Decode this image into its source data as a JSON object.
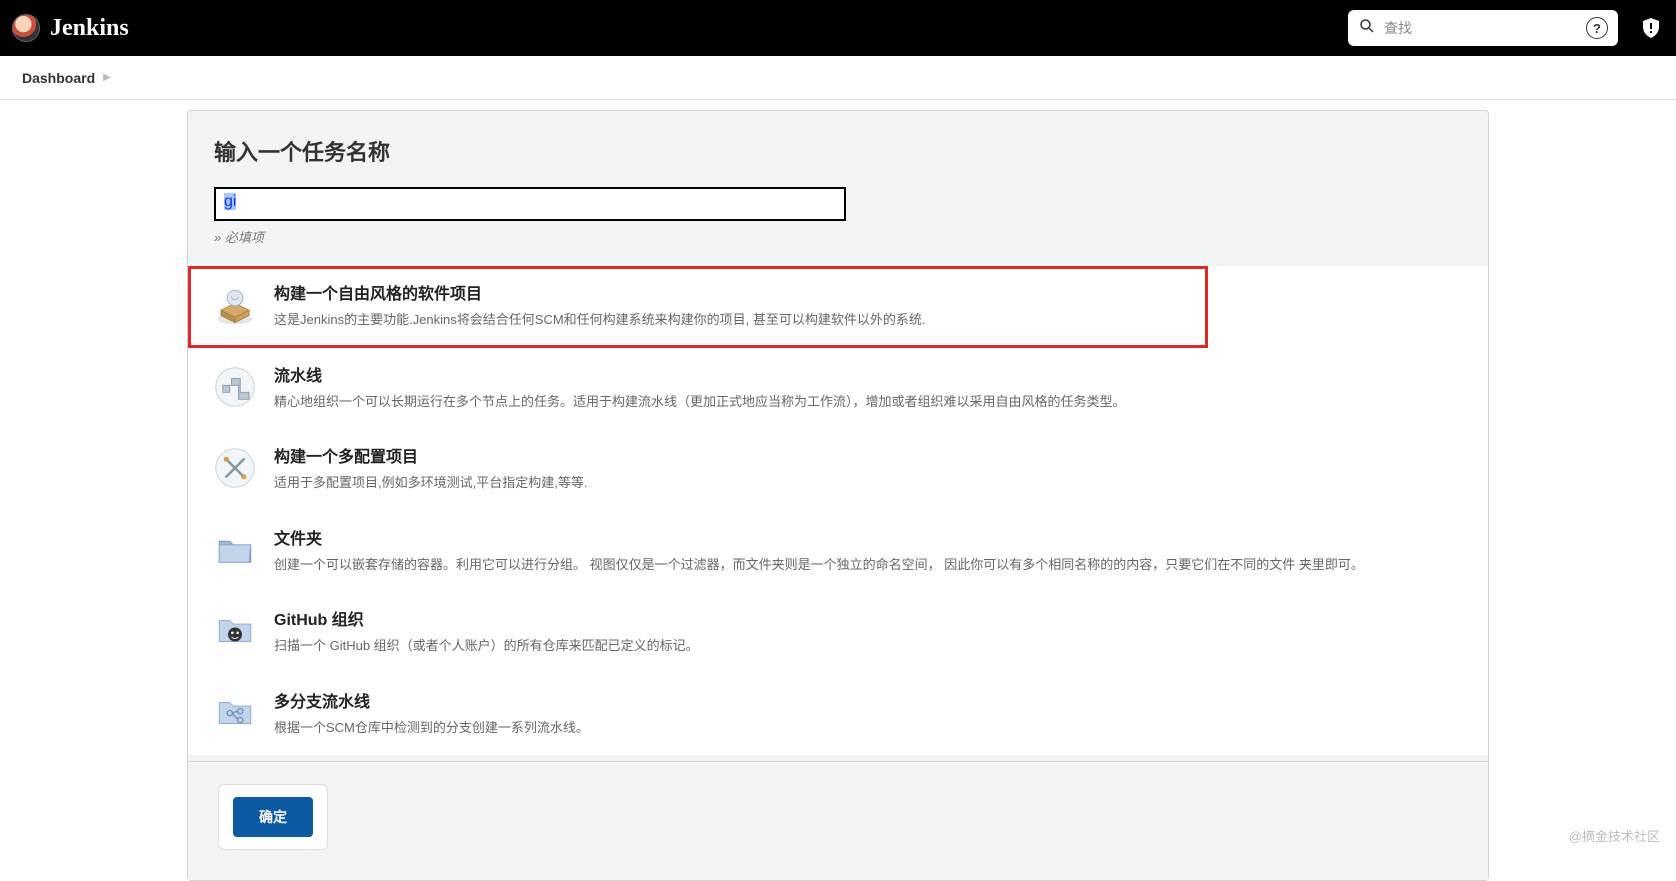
{
  "header": {
    "brand": "Jenkins",
    "search_placeholder": "查找"
  },
  "breadcrumb": {
    "item": "Dashboard"
  },
  "name_section": {
    "title": "输入一个任务名称",
    "value": "gi",
    "hint": "» 必填项"
  },
  "items": [
    {
      "id": "freestyle",
      "title": "构建一个自由风格的软件项目",
      "desc": "这是Jenkins的主要功能.Jenkins将会结合任何SCM和任何构建系统来构建你的项目, 甚至可以构建软件以外的系统.",
      "highlighted": true
    },
    {
      "id": "pipeline",
      "title": "流水线",
      "desc": "精心地组织一个可以长期运行在多个节点上的任务。适用于构建流水线（更加正式地应当称为工作流），增加或者组织难以采用自由风格的任务类型。"
    },
    {
      "id": "matrix",
      "title": "构建一个多配置项目",
      "desc": "适用于多配置项目,例如多环境测试,平台指定构建,等等."
    },
    {
      "id": "folder",
      "title": "文件夹",
      "desc": "创建一个可以嵌套存储的容器。利用它可以进行分组。 视图仅仅是一个过滤器，而文件夹则是一个独立的命名空间， 因此你可以有多个相同名称的的内容，只要它们在不同的文件 夹里即可。"
    },
    {
      "id": "github-org",
      "title": "GitHub 组织",
      "desc": "扫描一个 GitHub 组织（或者个人账户）的所有仓库来匹配已定义的标记。"
    },
    {
      "id": "multibranch",
      "title": "多分支流水线",
      "desc": "根据一个SCM仓库中检测到的分支创建一系列流水线。"
    }
  ],
  "footer": {
    "ok_label": "确定"
  },
  "watermark": "@摘金技术社区"
}
